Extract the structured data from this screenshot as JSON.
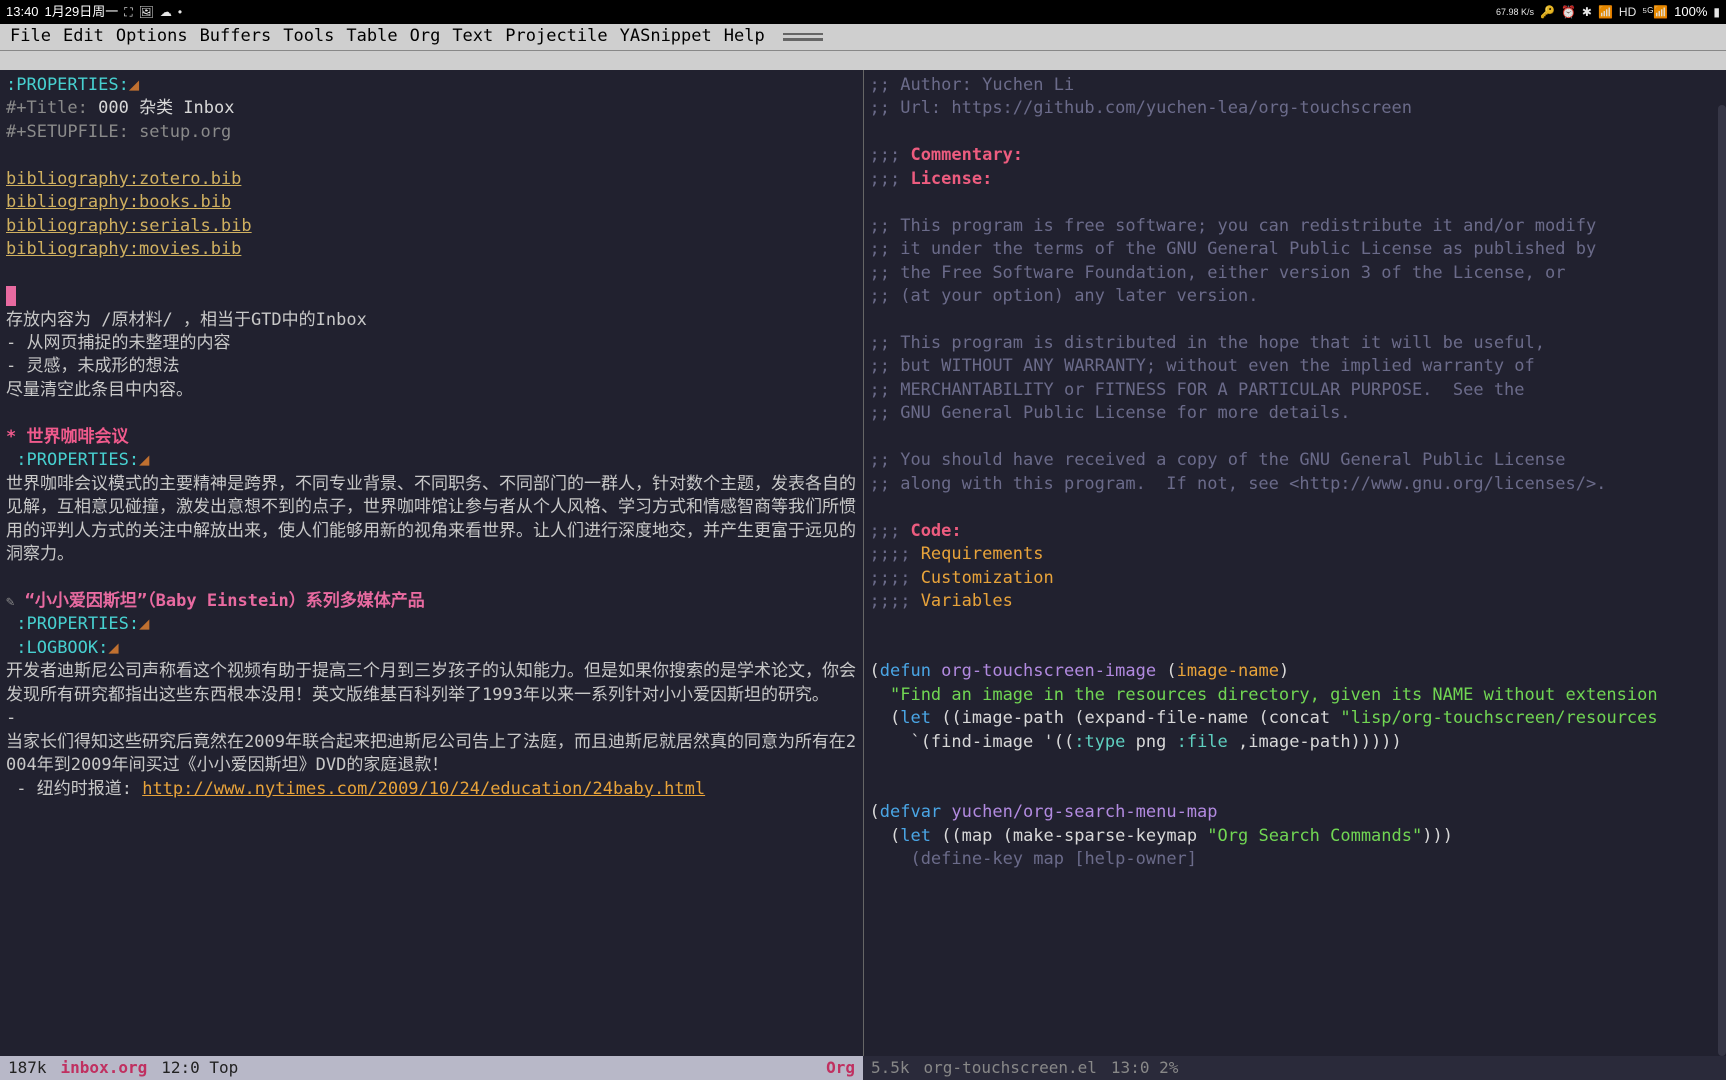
{
  "status": {
    "time": "13:40",
    "date": "1月29日周一",
    "net_speed": "67.98\nK/s",
    "battery": "100%"
  },
  "menu": {
    "items": [
      "File",
      "Edit",
      "Options",
      "Buffers",
      "Tools",
      "Table",
      "Org",
      "Text",
      "Projectile",
      "YASnippet",
      "Help"
    ]
  },
  "left": {
    "prop_open": ":PROPERTIES:",
    "title_kw": "#+Title:",
    "title_val": " 000 杂类 Inbox",
    "setup_kw": "#+SETUPFILE:",
    "setup_val": " setup.org",
    "bib1": "bibliography:zotero.bib",
    "bib2": "bibliography:books.bib",
    "bib3": "bibliography:serials.bib",
    "bib4": "bibliography:movies.bib",
    "intro1": "存放内容为 /原材料/ ，相当于GTD中的Inbox",
    "intro2": "- 从网页捕捉的未整理的内容",
    "intro3": "- 灵感，未成形的想法",
    "intro4": "尽量清空此条目中内容。",
    "h1_star": "* ",
    "h1_text": "世界咖啡会议",
    "h1_prop": " :PROPERTIES:",
    "h1_body": "世界咖啡会议模式的主要精神是跨界，不同专业背景、不同职务、不同部门的一群人，针对数个主题，发表各自的见解，互相意见碰撞，激发出意想不到的点子，世界咖啡馆让参与者从个人风格、学习方式和情感智商等我们所惯用的评判人方式的关注中解放出来，使人们能够用新的视角来看世界。让人们进行深度地交，并产生更富于远见的洞察力。",
    "h2_text": "“小小爱因斯坦”（Baby Einstein）系列多媒体产品",
    "h2_prop": " :PROPERTIES:",
    "h2_log": " :LOGBOOK:",
    "h2_body1": "开发者迪斯尼公司声称看这个视频有助于提高三个月到三岁孩子的认知能力。但是如果你搜索的是学术论文，你会发现所有研究都指出这些东西根本没用！英文版维基百科列举了1993年以来一系列针对小小爱因斯坦的研究。",
    "h2_dash": "-",
    "h2_body2": "当家长们得知这些研究后竟然在2009年联合起来把迪斯尼公司告上了法庭，而且迪斯尼就居然真的同意为所有在2004年到2009年间买过《小小爱因斯坦》DVD的家庭退款！",
    "h2_src_label": " - 纽约时报道: ",
    "h2_url": "http://www.nytimes.com/2009/10/24/education/24baby.html"
  },
  "right": {
    "author": ";; Author: Yuchen Li",
    "url": ";; Url: https://github.com/yuchen-lea/org-touchscreen",
    "commentary_p": ";;; ",
    "commentary": "Commentary:",
    "license_p": ";;; ",
    "license": "License:",
    "lic1": ";; This program is free software; you can redistribute it and/or modify",
    "lic2": ";; it under the terms of the GNU General Public License as published by",
    "lic3": ";; the Free Software Foundation, either version 3 of the License, or",
    "lic4": ";; (at your option) any later version.",
    "lic5": ";; This program is distributed in the hope that it will be useful,",
    "lic6": ";; but WITHOUT ANY WARRANTY; without even the implied warranty of",
    "lic7": ";; MERCHANTABILITY or FITNESS FOR A PARTICULAR PURPOSE.  See the",
    "lic8": ";; GNU General Public License for more details.",
    "lic9": ";; You should have received a copy of the GNU General Public License",
    "lic10": ";; along with this program.  If not, see <http://www.gnu.org/licenses/>.",
    "code_p": ";;; ",
    "code": "Code:",
    "req_p": ";;;; ",
    "req": "Requirements",
    "cust_p": ";;;; ",
    "cust": "Customization",
    "vars_p": ";;;; ",
    "vars": "Variables",
    "defun_open": "(",
    "defun_kw": "defun",
    "defun_name": " org-touchscreen-image ",
    "defun_args_open": "(",
    "defun_arg": "image-name",
    "defun_args_close": ")",
    "doc": "  \"Find an image in the resources directory, given its NAME without extension",
    "let1": "  (",
    "let_kw": "let",
    "let_body": " ((image-path (expand-file-name (concat ",
    "let_str": "\"lisp/org-touchscreen/resources",
    "find": "    `(find-image '((",
    "find_type": ":type",
    "find_png": " png ",
    "find_file": ":file",
    "find_rest": " ,image-path)))))",
    "defvar_open": "(",
    "defvar_kw": "defvar",
    "defvar_name": " yuchen/org-search-menu-map",
    "defvar_let": "  (",
    "defvar_letk": "let",
    "defvar_body": " ((map (make-sparse-keymap ",
    "defvar_str": "\"Org Search Commands\"",
    "defvar_close": ")))",
    "defvar_tail": "    (define-key map [help-owner]"
  },
  "mode": {
    "left_size": "187k",
    "left_file": "inbox.org",
    "left_pos": "12:0 Top",
    "left_mode": "Org",
    "right_size": "5.5k",
    "right_file": "org-touchscreen.el",
    "right_pos": "13:0  2%"
  }
}
